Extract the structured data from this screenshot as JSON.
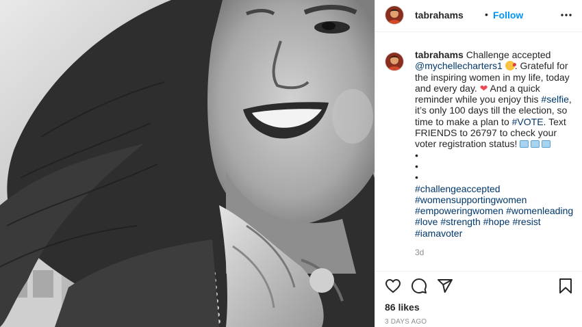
{
  "post": {
    "username": "tabrahams",
    "follow_label": "Follow",
    "separator": "•",
    "more_icon": "more-horizontal-icon",
    "caption": {
      "intro": "Challenge accepted",
      "mention": "@mychellecharters1",
      "text1": ". Grateful for the inspiring women in my life, today and every day.",
      "text2": "And a quick reminder while you enjoy this",
      "tag_selfie": "#selfie",
      "text3": ", it’s only 100 days till the election, so time to make a plan to",
      "tag_vote": "#VOTE",
      "text4": ". Text FRIENDS to 26797 to check your voter registration status!",
      "bullets": [
        "•",
        "•",
        "•"
      ],
      "hashtags_line1": [
        "#challengeaccepted"
      ],
      "hashtags_line2": [
        "#womensupportingwomen"
      ],
      "hashtags_line3": [
        "#empoweringwomen",
        "#womenleading"
      ],
      "hashtags_line4": [
        "#love",
        "#strength",
        "#hope",
        "#resist"
      ],
      "hashtags_line5": [
        "#iamavoter"
      ],
      "age": "3d"
    },
    "likes": "86 likes",
    "posted_ago": "3 DAYS AGO",
    "icons": {
      "like": "heart-icon",
      "comment": "comment-icon",
      "share": "paper-plane-icon",
      "save": "bookmark-icon"
    },
    "colors": {
      "follow": "#0095f6",
      "link": "#00376b",
      "heart": "#ed4956",
      "muted": "#8e8e8e"
    }
  }
}
